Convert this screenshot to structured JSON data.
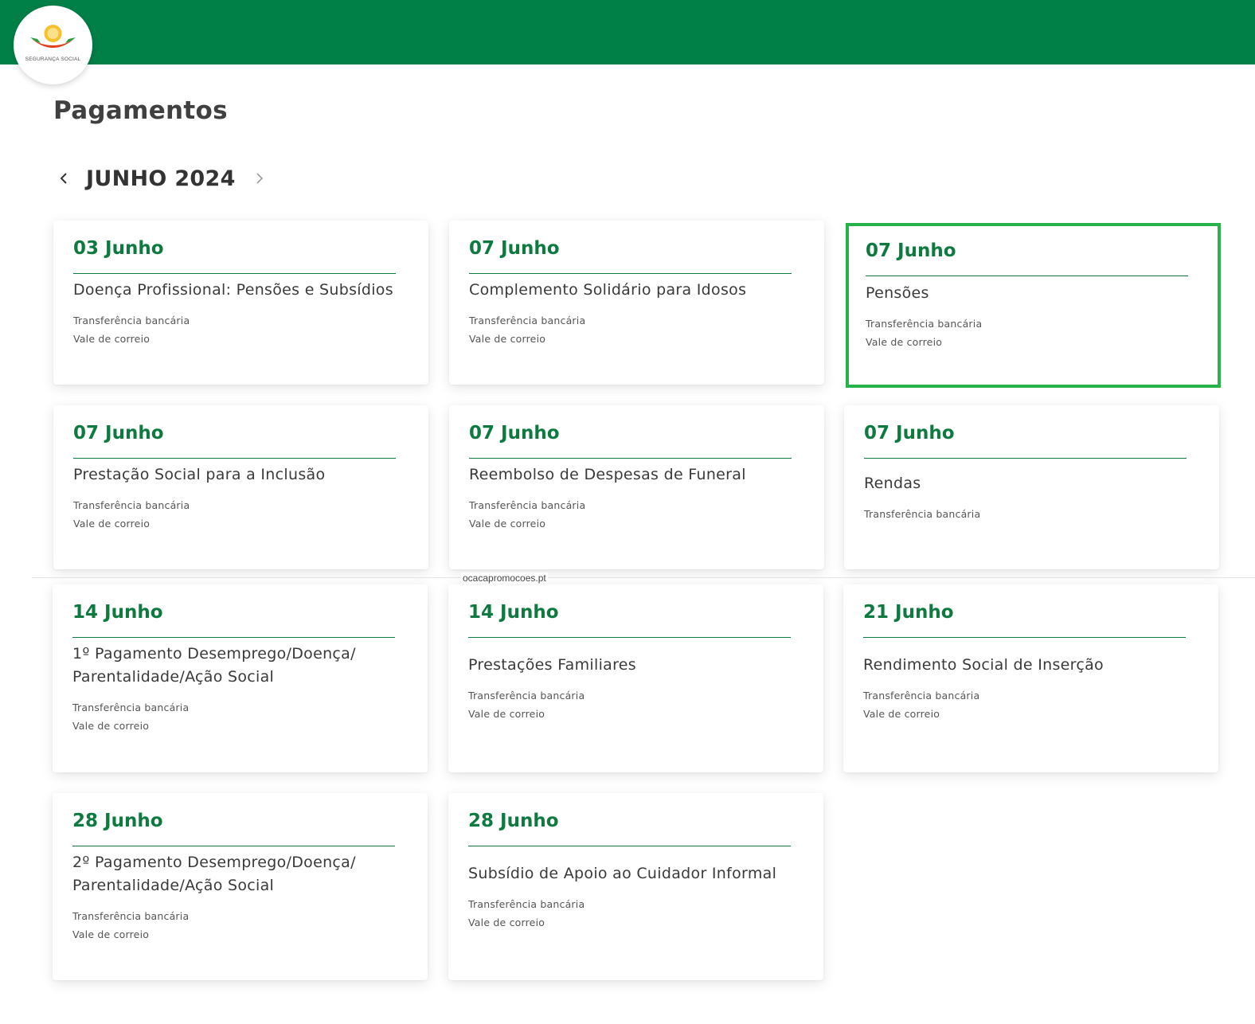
{
  "header": {
    "logo_text": "SEGURANÇA SOCIAL",
    "brand_color": "#008047"
  },
  "page": {
    "title": "Pagamentos"
  },
  "month_nav": {
    "label": "JUNHO 2024",
    "prev_icon": "chevron-left-icon",
    "next_icon": "chevron-right-icon"
  },
  "cards": [
    {
      "date": "03 Junho",
      "title": "Doença Profissional: Pensões e Subsídios",
      "methods": [
        "Transferência bancária",
        "Vale de correio"
      ]
    },
    {
      "date": "07 Junho",
      "title": "Complemento Solidário para Idosos",
      "methods": [
        "Transferência bancária",
        "Vale de correio"
      ]
    },
    {
      "date": "07 Junho",
      "title": "Pensões",
      "methods": [
        "Transferência bancária",
        "Vale de correio"
      ],
      "highlighted": true
    },
    {
      "date": "07 Junho",
      "title": "Prestação Social para a Inclusão",
      "methods": [
        "Transferência bancária",
        "Vale de correio"
      ]
    },
    {
      "date": "07 Junho",
      "title": "Reembolso de Despesas de Funeral",
      "methods": [
        "Transferência bancária",
        "Vale de correio"
      ]
    },
    {
      "date": "07 Junho",
      "title": "Rendas",
      "methods": [
        "Transferência bancária"
      ]
    },
    {
      "date": "14 Junho",
      "title": "1º Pagamento Desemprego/Doença/ Parentalidade/Ação Social",
      "methods": [
        "Transferência bancária",
        "Vale de correio"
      ]
    },
    {
      "date": "14 Junho",
      "title": "Prestações Familiares",
      "methods": [
        "Transferência bancária",
        "Vale de correio"
      ]
    },
    {
      "date": "21 Junho",
      "title": "Rendimento Social de Inserção",
      "methods": [
        "Transferência bancária",
        "Vale de correio"
      ]
    },
    {
      "date": "28 Junho",
      "title": "2º Pagamento Desemprego/Doença/ Parentalidade/Ação Social",
      "methods": [
        "Transferência bancária",
        "Vale de correio"
      ]
    },
    {
      "date": "28 Junho",
      "title": "Subsídio de Apoio ao Cuidador Informal",
      "methods": [
        "Transferência bancária",
        "Vale de correio"
      ]
    }
  ],
  "watermark": "ocacapromocoes.pt",
  "colors": {
    "accent": "#0e7a3f",
    "highlight_border": "#27b24a"
  }
}
